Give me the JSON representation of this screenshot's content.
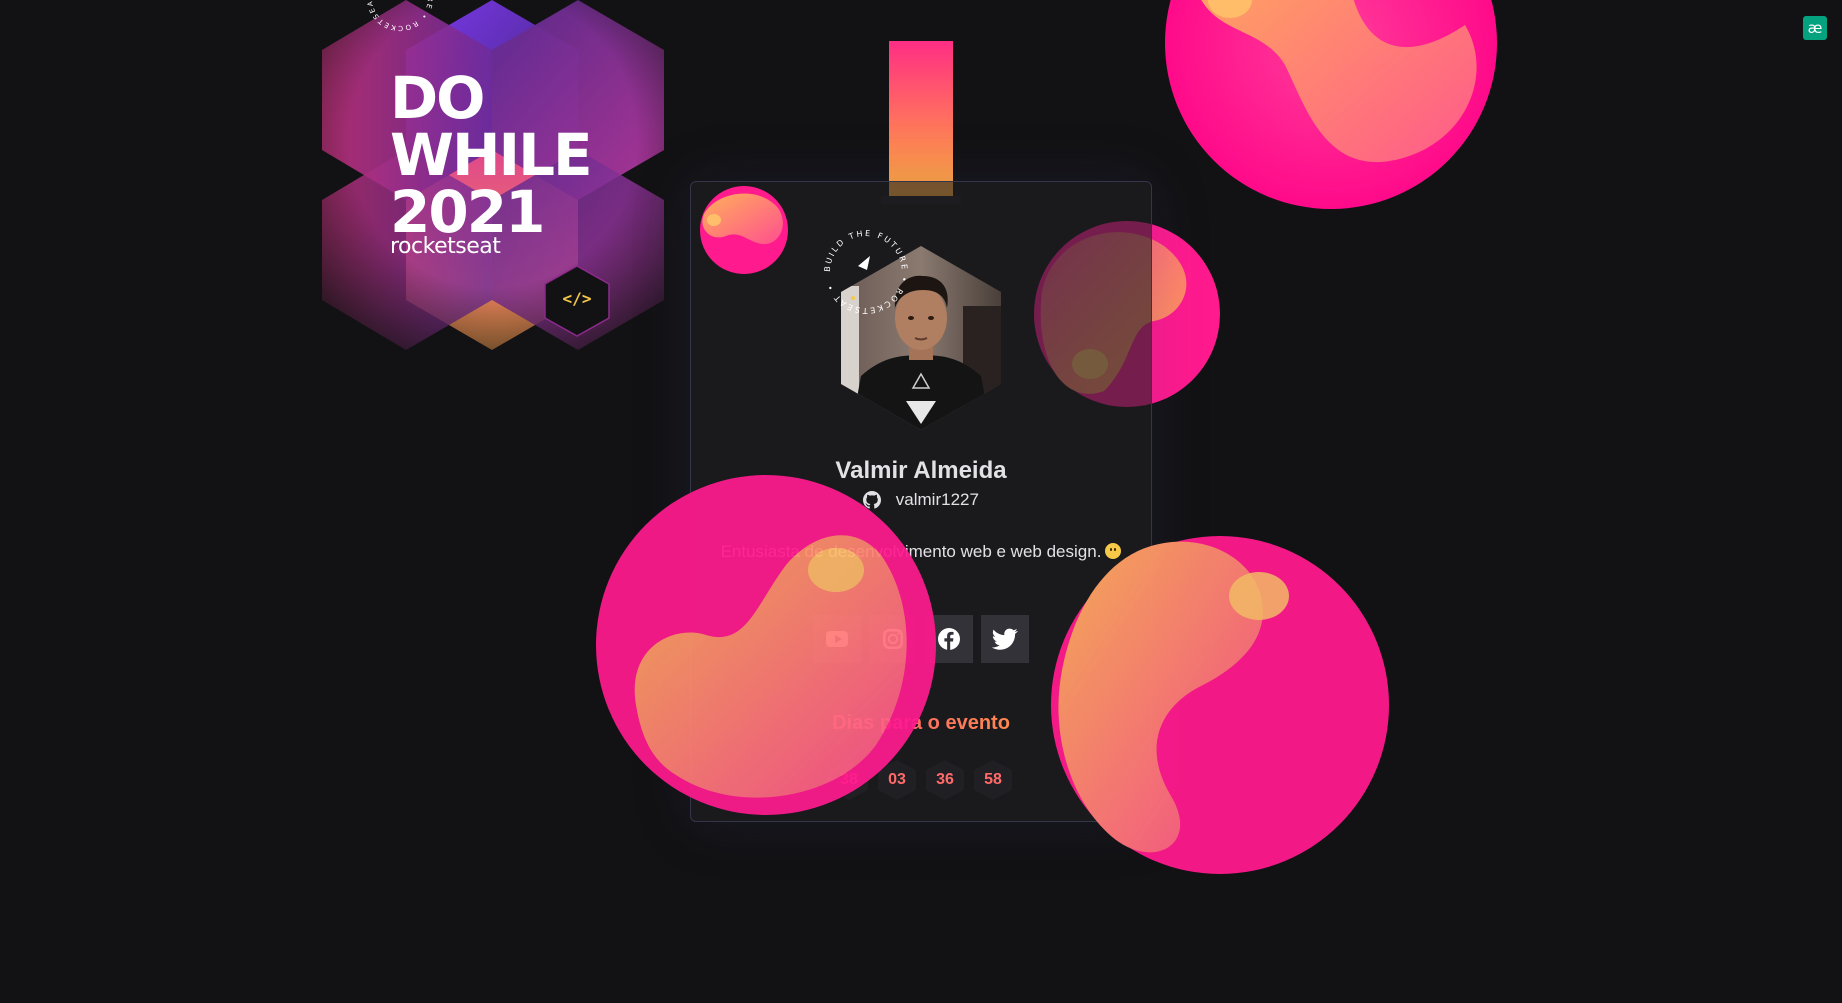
{
  "hero": {
    "title_line1": "DO",
    "title_line2": "WHILE",
    "title_line3": "2021",
    "brand": "rocketseat",
    "code_badge": "</>",
    "ring_text": "BUILD THE FUTURE • ROCKETSEAT •"
  },
  "corner_badge": {
    "label": "æ",
    "color": "#04a27e"
  },
  "card": {
    "avatar_ring_text": "BUILD THE FUTURE • ROCKETSEAT •",
    "name": "Valmir Almeida",
    "github_username": "valmir1227",
    "bio": "Entusiasta de desenvolvimento web e web design.",
    "socials": [
      {
        "name": "youtube",
        "icon": "youtube-icon"
      },
      {
        "name": "instagram",
        "icon": "instagram-icon"
      },
      {
        "name": "facebook",
        "icon": "facebook-icon"
      },
      {
        "name": "twitter",
        "icon": "twitter-icon"
      }
    ],
    "countdown_title": "Dias para o evento",
    "countdown": [
      "38",
      "03",
      "36",
      "58"
    ]
  },
  "colors": {
    "background": "#121214",
    "accent_pink": "#ff2e84",
    "accent_orange": "#ffb13a",
    "accent_yellow": "#f7c948",
    "button_bg": "#323238"
  }
}
